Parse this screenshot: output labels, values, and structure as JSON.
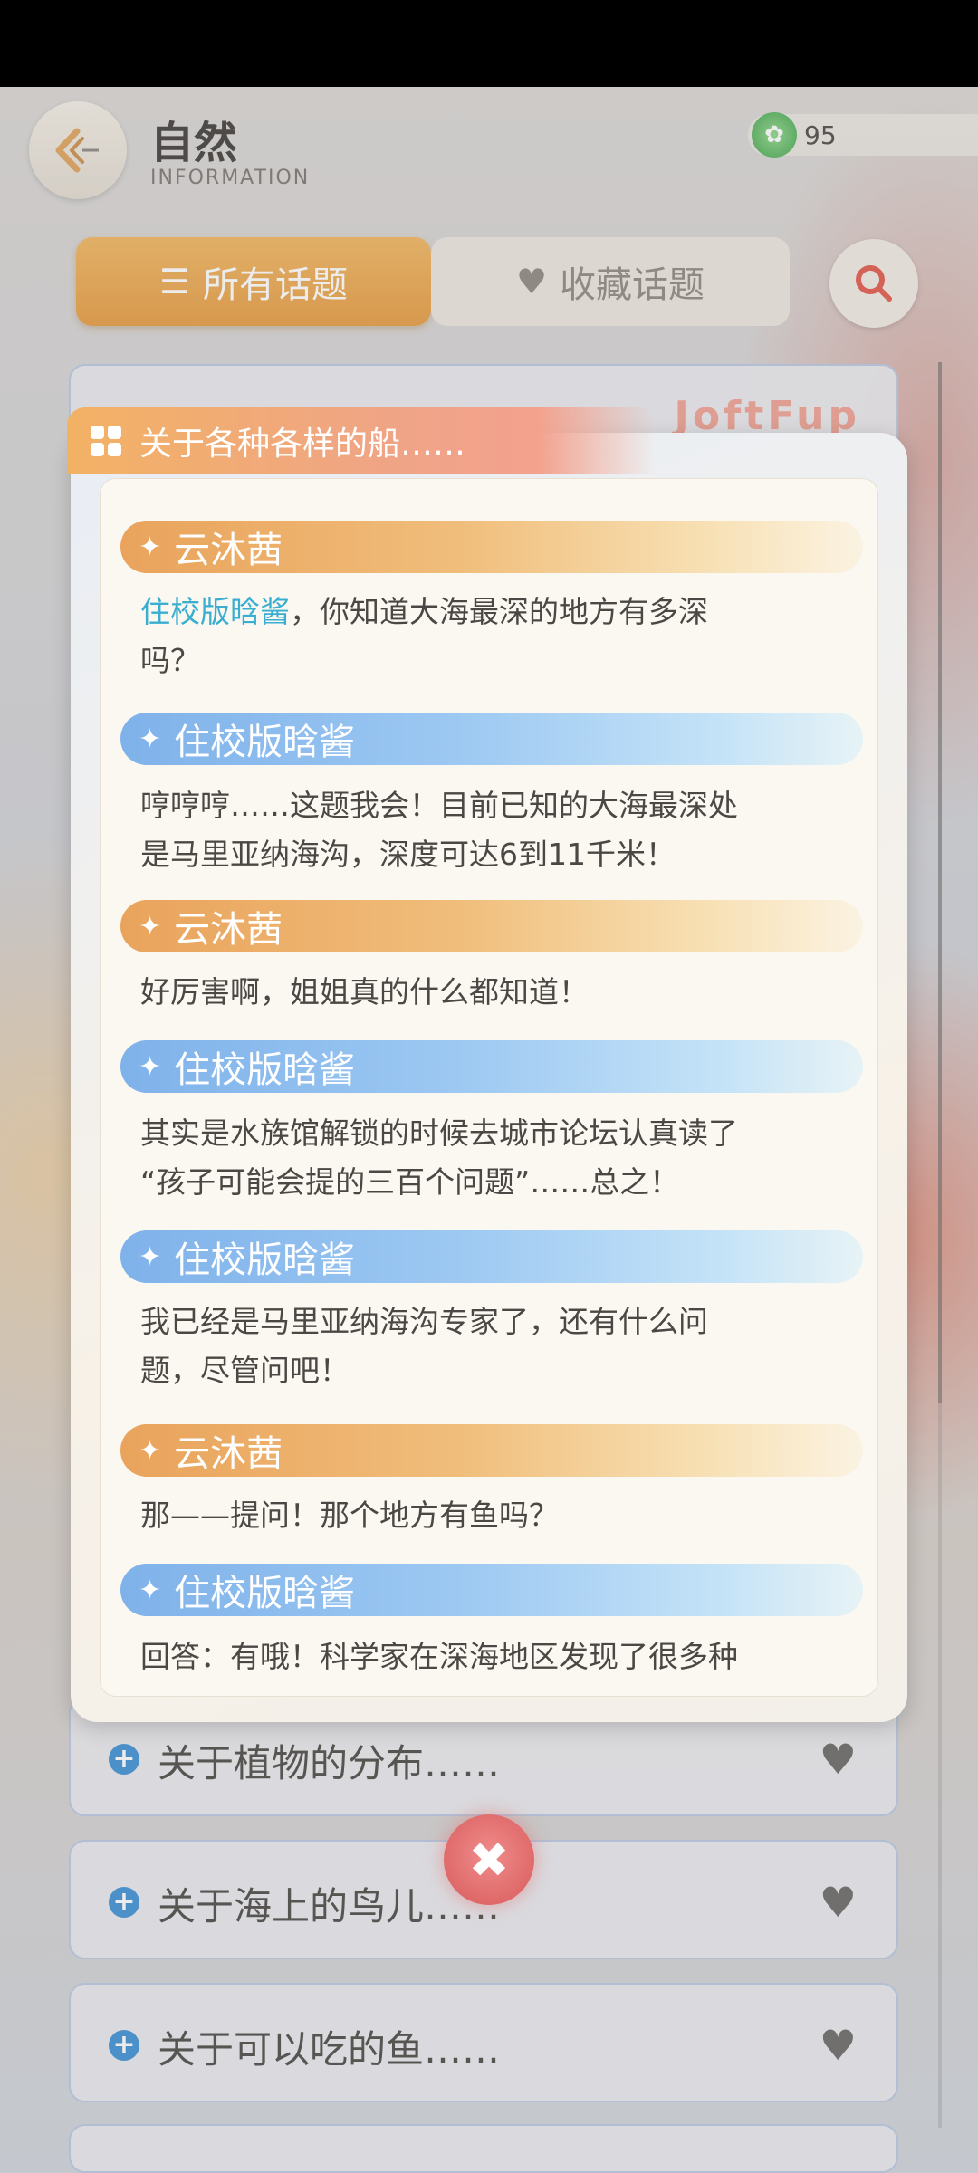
{
  "header": {
    "title": "自然",
    "subtitle": "INFORMATION",
    "currency_value": "95"
  },
  "tabs": {
    "all_label": "所有话题",
    "fav_label": "收藏话题"
  },
  "behind_card_partial_text": "JoftFup",
  "topics": [
    {
      "label": "关于植物的分布……"
    },
    {
      "label": "关于海上的鸟儿……"
    },
    {
      "label": "关于可以吃的鱼……"
    }
  ],
  "dialog": {
    "title": "关于各种各样的船……",
    "entries": [
      {
        "speaker": "云沐茜",
        "color": "orange",
        "highlight": "住校版晗酱",
        "text_lines": [
          "，你知道大海最深的地方有多深",
          "吗？"
        ]
      },
      {
        "speaker": "住校版晗酱",
        "color": "blue",
        "highlight": "",
        "text_lines": [
          "哼哼哼……这题我会！目前已知的大海最深处",
          "是马里亚纳海沟，深度可达6到11千米！"
        ]
      },
      {
        "speaker": "云沐茜",
        "color": "orange",
        "highlight": "",
        "text_lines": [
          "好厉害啊，姐姐真的什么都知道！"
        ]
      },
      {
        "speaker": "住校版晗酱",
        "color": "blue",
        "highlight": "",
        "text_lines": [
          "其实是水族馆解锁的时候去城市论坛认真读了",
          "“孩子可能会提的三百个问题”……总之！"
        ]
      },
      {
        "speaker": "住校版晗酱",
        "color": "blue",
        "highlight": "",
        "text_lines": [
          "我已经是马里亚纳海沟专家了，还有什么问",
          "题，尽管问吧！"
        ]
      },
      {
        "speaker": "云沐茜",
        "color": "orange",
        "highlight": "",
        "text_lines": [
          "那——提问！那个地方有鱼吗？"
        ]
      },
      {
        "speaker": "住校版晗酱",
        "color": "blue",
        "highlight": "",
        "text_lines": [
          "回答：有哦！科学家在深海地区发现了很多种"
        ]
      }
    ]
  },
  "colors": {
    "accent_orange": "#e69a3e",
    "speaker_blue": "#7fb2ea",
    "highlight": "#3aaed0"
  }
}
